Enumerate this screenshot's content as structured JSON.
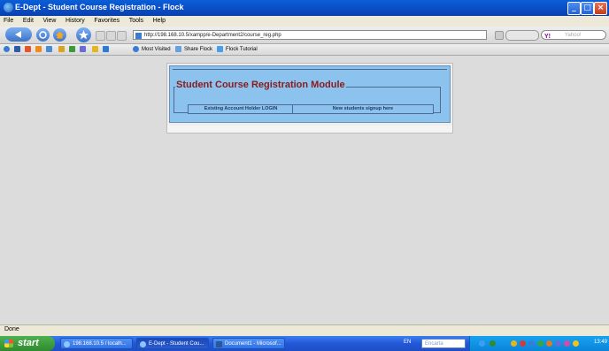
{
  "window": {
    "title": "E-Dept - Student Course Registration - Flock"
  },
  "menu": [
    "File",
    "Edit",
    "View",
    "History",
    "Favorites",
    "Tools",
    "Help"
  ],
  "navigation": {
    "url": "http://198.168.10.5/xampp/e-Department2/course_reg.php",
    "search_placeholder": "Yahoo!"
  },
  "bookmarks": [
    "Most Visited",
    "Share Flock",
    "Flock Tutorial"
  ],
  "page": {
    "legend": "Student Course Registration Module",
    "login_label": "Existing Account Holder LOGIN",
    "signup_label": "New students signup here"
  },
  "status": {
    "text": "Done"
  },
  "taskbar": {
    "start_label": "start",
    "tasks": [
      "198.168.10.5 / localh...",
      "E-Dept - Student Cou...",
      "Document1 - Microsof..."
    ],
    "language": "EN",
    "search_placeholder": "Encarta",
    "clock": "13:49"
  }
}
